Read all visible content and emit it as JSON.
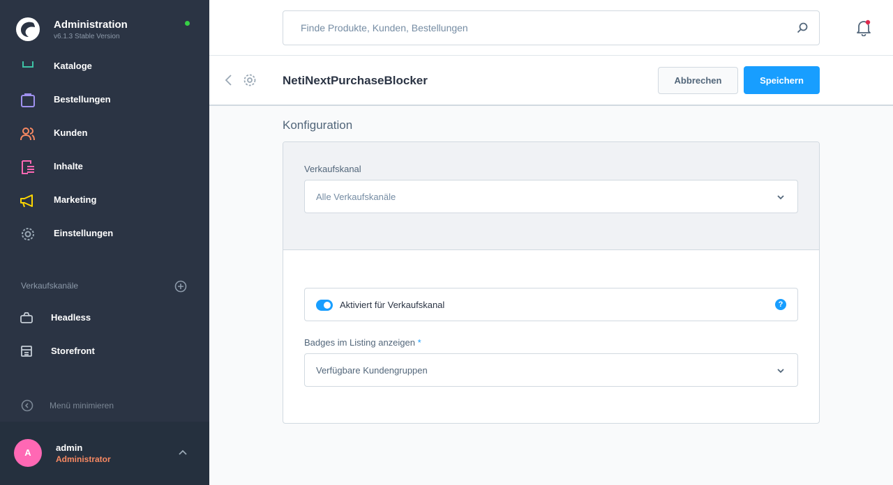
{
  "brand": {
    "title": "Administration",
    "version": "v6.1.3 Stable Version",
    "status_color": "#37d046"
  },
  "nav": {
    "items": [
      {
        "label": "Kataloge",
        "icon": "catalog-icon",
        "color": "#3ec3a6"
      },
      {
        "label": "Bestellungen",
        "icon": "bag-icon",
        "color": "#a092f0"
      },
      {
        "label": "Kunden",
        "icon": "users-icon",
        "color": "#f88962"
      },
      {
        "label": "Inhalte",
        "icon": "content-icon",
        "color": "#ff68b4"
      },
      {
        "label": "Marketing",
        "icon": "megaphone-icon",
        "color": "#ffd700"
      },
      {
        "label": "Einstellungen",
        "icon": "gear-icon",
        "color": "#9aa8b5"
      }
    ]
  },
  "sales_channels": {
    "header": "Verkaufskanäle",
    "items": [
      {
        "label": "Headless",
        "icon": "basket-icon"
      },
      {
        "label": "Storefront",
        "icon": "storefront-icon"
      }
    ]
  },
  "minimize_label": "Menü minimieren",
  "user": {
    "initial": "A",
    "name": "admin",
    "role": "Administrator"
  },
  "search": {
    "placeholder": "Finde Produkte, Kunden, Bestellungen"
  },
  "smartbar": {
    "title": "NetiNextPurchaseBlocker",
    "cancel_label": "Abbrechen",
    "save_label": "Speichern"
  },
  "config": {
    "section_title": "Konfiguration",
    "sales_channel": {
      "label": "Verkaufskanal",
      "value": "Alle Verkaufskanäle"
    },
    "toggle": {
      "label": "Aktiviert für Verkaufskanal",
      "enabled": true
    },
    "badges": {
      "label": "Badges im Listing anzeigen",
      "required_mark": "*",
      "value": "Verfügbare Kundengruppen"
    }
  },
  "colors": {
    "accent": "#189eff",
    "sidebar": "#2b3444",
    "avatar": "#ff68b4",
    "role": "#f88962"
  }
}
